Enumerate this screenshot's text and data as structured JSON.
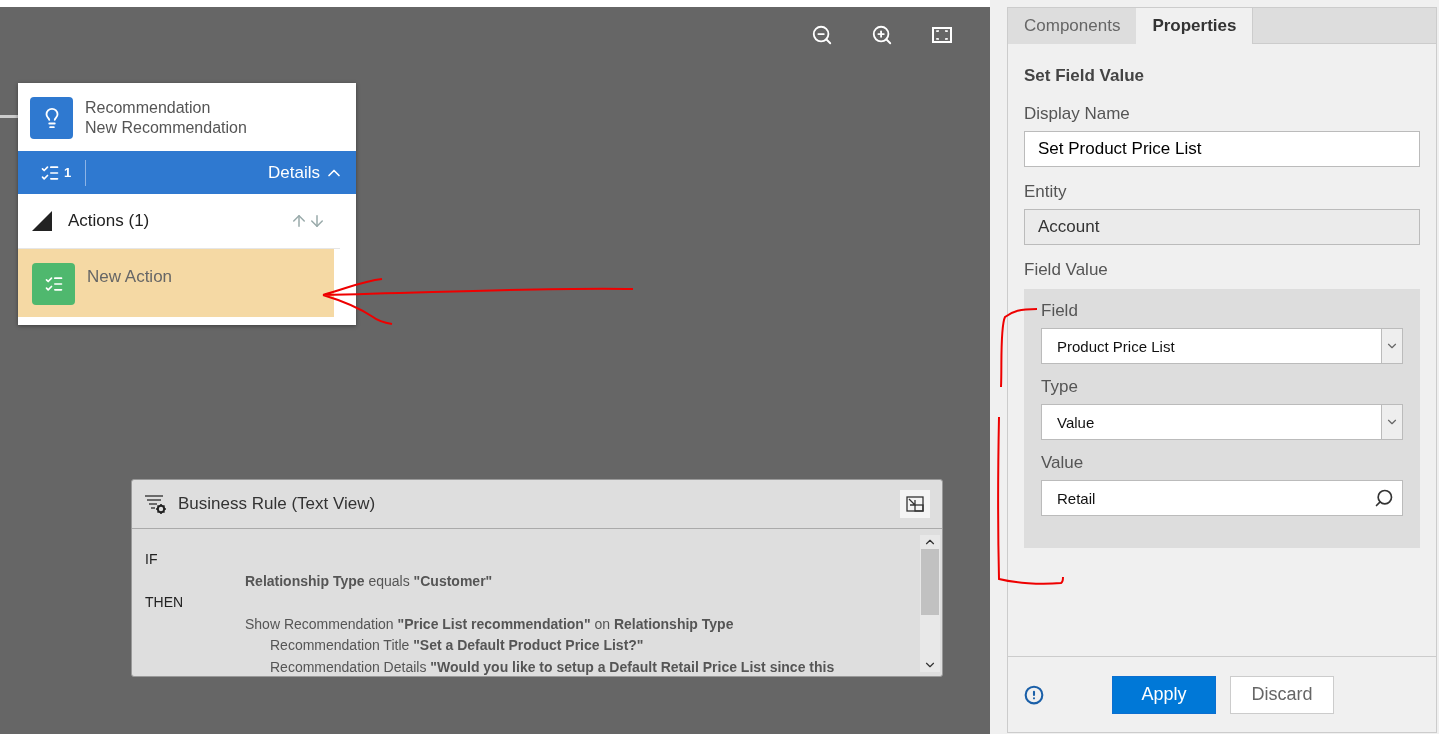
{
  "node": {
    "title": "Recommendation",
    "subtitle": "New Recommendation",
    "count": "1",
    "details_label": "Details",
    "details_expanded": true,
    "actions_header": "Actions (1)",
    "actions_expanded": true,
    "actions": [
      {
        "label": "New Action",
        "selected": true
      }
    ]
  },
  "business_rule": {
    "title": "Business Rule (Text View)",
    "lines": [
      {
        "kind": "keyword",
        "text": "IF"
      },
      {
        "kind": "statement",
        "text": "**Relationship Type** equals **\"Customer\"**"
      },
      {
        "kind": "keyword",
        "text": "THEN"
      },
      {
        "kind": "statement",
        "text": "Show Recommendation **\"Price List recommendation\"** on **Relationship Type**"
      },
      {
        "kind": "detail",
        "text": "Recommendation Title **\"Set a Default Product Price List?\"**"
      },
      {
        "kind": "detail",
        "text": "Recommendation Details **\"Would you like to setup a Default Retail Price List since this**"
      }
    ]
  },
  "panel": {
    "tabs": [
      {
        "label": "Components",
        "selected": false
      },
      {
        "label": "Properties",
        "selected": true
      }
    ],
    "heading": "Set Field Value",
    "fields": [
      {
        "label": "Display Name",
        "value": "Set Product Price List",
        "disabled": false
      },
      {
        "label": "Entity",
        "value": "Account",
        "disabled": true
      }
    ],
    "field_value": {
      "label": "Field Value",
      "fields": [
        {
          "kind": "dropdown",
          "label": "Field",
          "value": "Product Price List"
        },
        {
          "kind": "dropdown",
          "label": "Type",
          "value": "Value"
        },
        {
          "kind": "lookup",
          "label": "Value",
          "value": "Retail"
        }
      ]
    },
    "buttons": [
      {
        "label": "Apply",
        "primary": true
      },
      {
        "label": "Discard",
        "primary": false
      }
    ]
  }
}
